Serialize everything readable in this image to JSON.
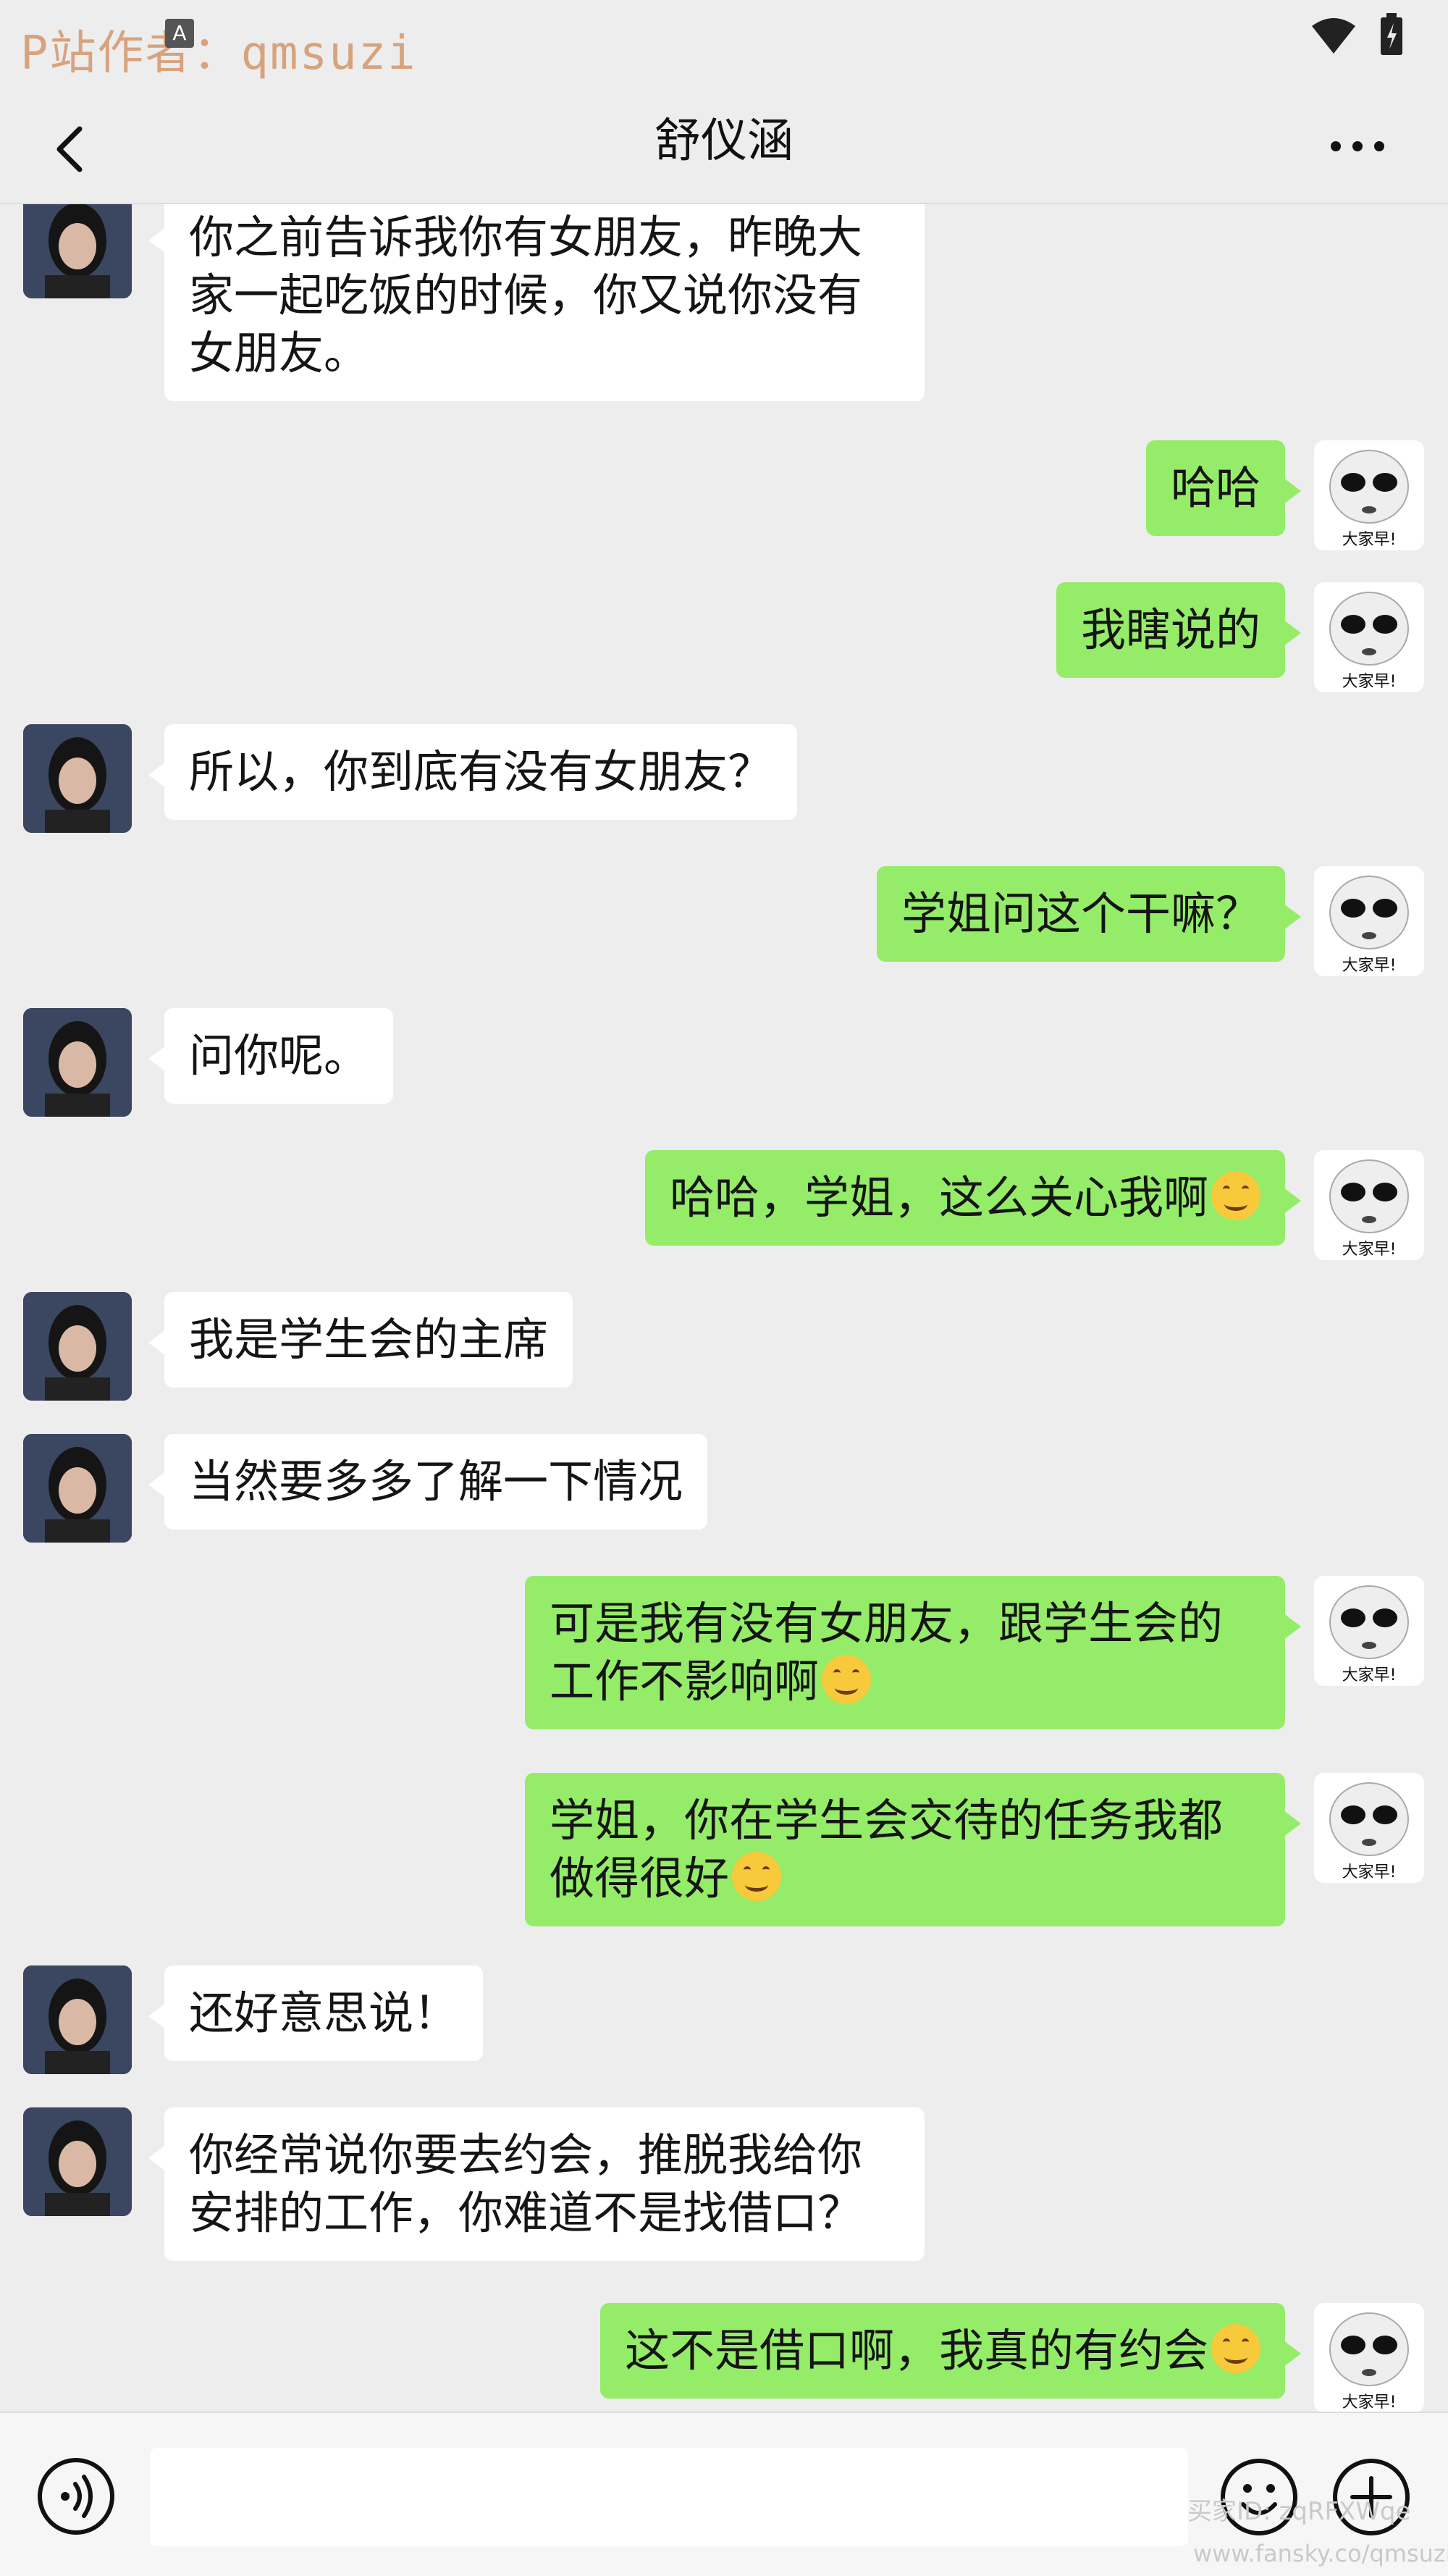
{
  "watermark": {
    "text": "P站作者：qmsuzi",
    "badge": "A"
  },
  "header": {
    "title": "舒仪涵",
    "back_icon": "chevron-left-icon",
    "more_icon": "ellipsis-icon"
  },
  "colors": {
    "background": "#ededed",
    "outgoing_bubble": "#95ec69",
    "incoming_bubble": "#ffffff"
  },
  "self_avatar_caption": "大家早!",
  "messages": [
    {
      "from": "other",
      "text": "你之前告诉我你有女朋友，昨晚大\n家一起吃饭的时候，你又说你没有\n女朋友。"
    },
    {
      "from": "me",
      "text": "哈哈"
    },
    {
      "from": "me",
      "text": "我瞎说的"
    },
    {
      "from": "other",
      "text": "所以，你到底有没有女朋友？"
    },
    {
      "from": "me",
      "text": "学姐问这个干嘛？"
    },
    {
      "from": "other",
      "text": "问你呢。"
    },
    {
      "from": "me",
      "text": "哈哈，学姐，这么关心我啊",
      "emoji": "laughing-emoji"
    },
    {
      "from": "other",
      "text": "我是学生会的主席"
    },
    {
      "from": "other",
      "text": "当然要多多了解一下情况"
    },
    {
      "from": "me",
      "text": "可是我有没有女朋友，跟学生会的\n工作不影响啊",
      "emoji": "smile-emoji"
    },
    {
      "from": "me",
      "text": "学姐，你在学生会交待的任务我都\n做得很好",
      "emoji": "smile-emoji"
    },
    {
      "from": "other",
      "text": "还好意思说！"
    },
    {
      "from": "other",
      "text": "你经常说你要去约会，推脱我给你\n安排的工作，你难道不是找借口？"
    },
    {
      "from": "me",
      "text": "这不是借口啊，我真的有约会",
      "emoji": "laughing-tears-emoji"
    }
  ],
  "input_bar": {
    "value": "",
    "voice_icon": "voice-icon",
    "emoji_icon": "emoji-icon",
    "plus_icon": "plus-icon"
  },
  "corner_watermark": {
    "line1": "买家ID: zqRFXWqe",
    "line2": "www.fansky.co/qmsuzi"
  }
}
